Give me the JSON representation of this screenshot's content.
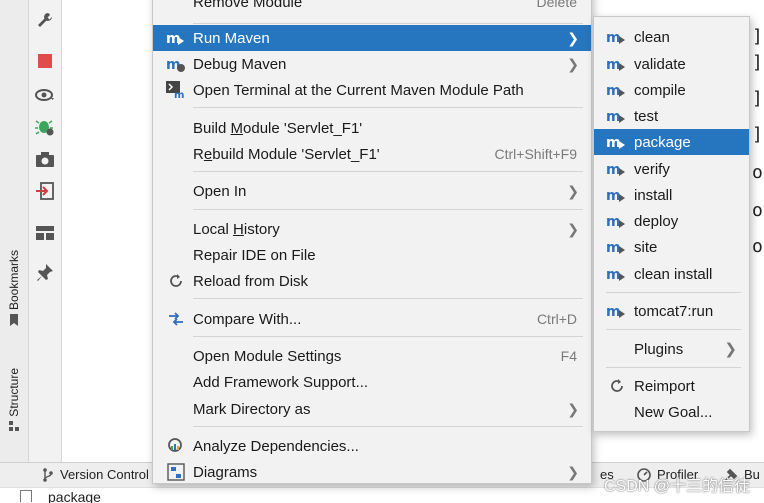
{
  "left_tabs": {
    "bookmarks": "Bookmarks",
    "structure": "Structure"
  },
  "tool_icons": [
    "wrench-icon",
    "stop-icon",
    "eye-icon",
    "bug-settings-icon",
    "camera-icon",
    "login-icon",
    "layout-icon",
    "pin-icon"
  ],
  "context_menu": {
    "items": [
      {
        "label": "Remove Module",
        "shortcut": "Delete"
      },
      {
        "label": "Run Maven"
      },
      {
        "label": "Debug Maven"
      },
      {
        "label": "Open Terminal at the Current Maven Module Path"
      },
      {
        "label_pre": "Build ",
        "label_u": "M",
        "label_post": "odule 'Servlet_F1'"
      },
      {
        "label_pre": "R",
        "label_u": "e",
        "label_post": "build Module 'Servlet_F1'",
        "shortcut": "Ctrl+Shift+F9"
      },
      {
        "label": "Open In"
      },
      {
        "label_pre": "Local ",
        "label_u": "H",
        "label_post": "istory"
      },
      {
        "label": "Repair IDE on File"
      },
      {
        "label": "Reload from Disk"
      },
      {
        "label": "Compare With...",
        "shortcut": "Ctrl+D"
      },
      {
        "label": "Open Module Settings",
        "shortcut": "F4"
      },
      {
        "label": "Add Framework Support..."
      },
      {
        "label": "Mark Directory as"
      },
      {
        "label": "Analyze Dependencies..."
      },
      {
        "label": "Diagrams"
      }
    ]
  },
  "maven_submenu": {
    "items": [
      {
        "label": "clean"
      },
      {
        "label": "validate"
      },
      {
        "label": "compile"
      },
      {
        "label": "test"
      },
      {
        "label": "package"
      },
      {
        "label": "verify"
      },
      {
        "label": "install"
      },
      {
        "label": "deploy"
      },
      {
        "label": "site"
      },
      {
        "label": "clean install"
      },
      {
        "label": "tomcat7:run"
      },
      {
        "label": "Plugins"
      },
      {
        "label": "Reimport"
      },
      {
        "label": "New Goal..."
      }
    ]
  },
  "editor_fragments": [
    "]",
    "]",
    "]",
    "]",
    "o",
    "o",
    "o"
  ],
  "bottom_bar": {
    "version_control": "Version Control",
    "services_tail": "es",
    "profiler": "Profiler",
    "build_tail": "Bu",
    "watermark": "CSDN @十三的信徒",
    "package_row": "package"
  },
  "colors": {
    "selection": "#2675bf",
    "menu_bg": "#f2f2f2",
    "maven_icon": "#2e6fbf",
    "stop_red": "#e04b4b"
  }
}
